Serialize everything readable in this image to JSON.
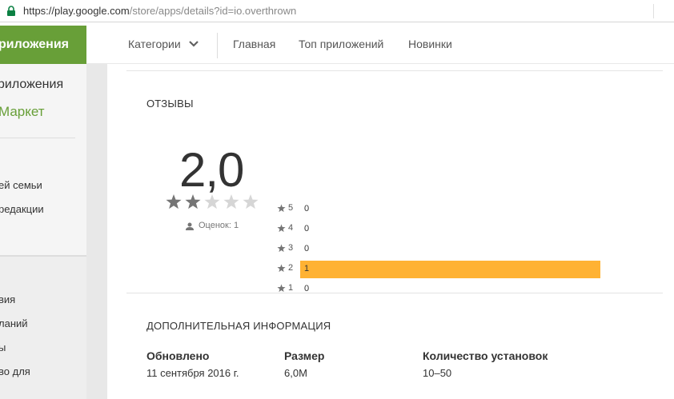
{
  "browser": {
    "url_main": "https://play.google.com",
    "url_rest": "/store/apps/details?id=io.overthrown"
  },
  "header": {
    "section_label": "риложения"
  },
  "nav": {
    "categories": "Категории",
    "home": "Главная",
    "top_apps": "Топ приложений",
    "new": "Новинки"
  },
  "sidebar": {
    "title": "риложения",
    "market": "Маркет",
    "links": [
      "ей семьи",
      "редакции"
    ],
    "lower_links": [
      "вия",
      "ланий",
      "ы",
      "во для"
    ]
  },
  "reviews": {
    "title": "ОТЗЫВЫ",
    "score": "2,0",
    "stars_filled": 2,
    "stars_total": 5,
    "count_label": "Оценок: 1",
    "histogram": [
      {
        "label": "5",
        "count": "0",
        "fraction": 0
      },
      {
        "label": "4",
        "count": "0",
        "fraction": 0
      },
      {
        "label": "3",
        "count": "0",
        "fraction": 0
      },
      {
        "label": "2",
        "count": "1",
        "fraction": 1
      },
      {
        "label": "1",
        "count": "0",
        "fraction": 0
      }
    ],
    "bar_color": "#ffb233"
  },
  "info": {
    "title": "ДОПОЛНИТЕЛЬНАЯ ИНФОРМАЦИЯ",
    "columns": [
      {
        "label": "Обновлено",
        "value": "11 сентября 2016 г."
      },
      {
        "label": "Размер",
        "value": "6,0M"
      },
      {
        "label": "Количество установок",
        "value": "10–50"
      }
    ]
  },
  "colors": {
    "brand_green": "#689f38",
    "star_filled": "#757575",
    "star_empty": "#d6d6d6"
  }
}
